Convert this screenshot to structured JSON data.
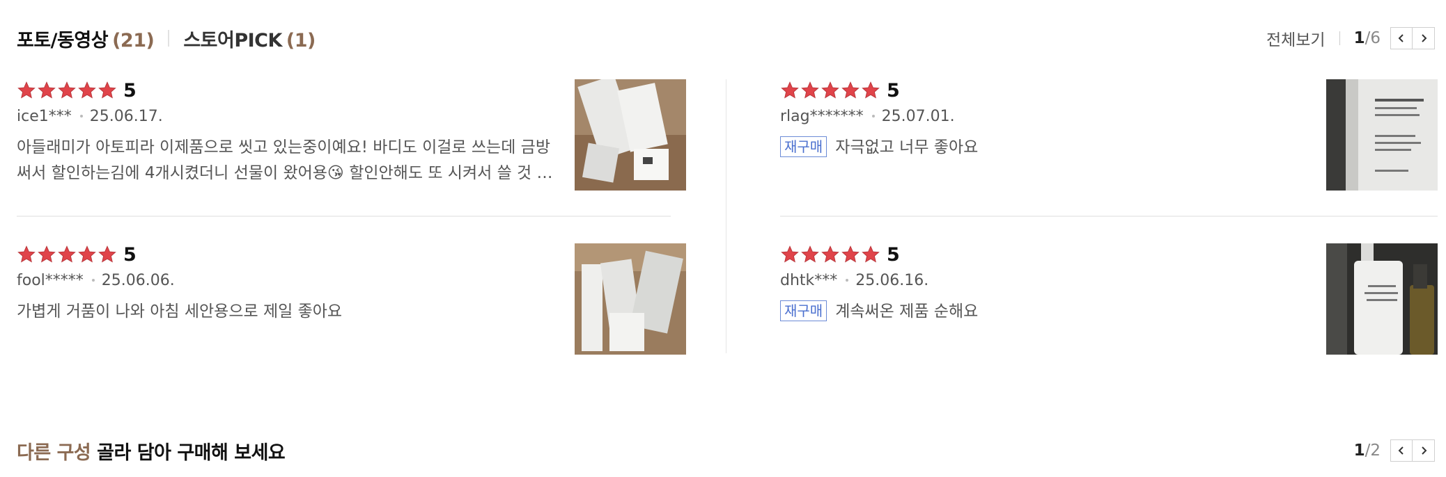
{
  "colors": {
    "accent_brown": "#8b6a52",
    "star_red": "#e0444a",
    "rebuy_blue": "#4a6fcf"
  },
  "header": {
    "tab_photo": {
      "label": "포토/동영상",
      "count": "(21)"
    },
    "tab_pick": {
      "label": "스토어PICK",
      "count": "(1)"
    },
    "view_all": "전체보기",
    "page_current": "1",
    "page_total": "/6",
    "prev_icon": "chevron-left-icon",
    "next_icon": "chevron-right-icon"
  },
  "reviews": [
    {
      "rating": "5",
      "user": "ice1***",
      "date": "25.06.17.",
      "text": "아들래미가 아토피라 이제품으로 씻고 있는중이예요! 바디도 이걸로 쓰는데 금방 써서 할인하는김에 4개시켰더니 선물이 왔어용😘 할인안해도 또 시켜서 쓸 것 같아요",
      "rebuy": ""
    },
    {
      "rating": "5",
      "user": "rlag*******",
      "date": "25.07.01.",
      "text": "자극없고 너무 좋아요",
      "rebuy": "재구매"
    },
    {
      "rating": "5",
      "user": "fool*****",
      "date": "25.06.06.",
      "text": "가볍게 거품이 나와 아침 세안용으로 제일 좋아요",
      "rebuy": ""
    },
    {
      "rating": "5",
      "user": "dhtk***",
      "date": "25.06.16.",
      "text": "계속써온 제품 순해요",
      "rebuy": "재구매"
    }
  ],
  "bundle": {
    "title_accent": "다른 구성",
    "title_rest": " 골라 담아 구매해 보세요",
    "page_current": "1",
    "page_total": "/2"
  }
}
